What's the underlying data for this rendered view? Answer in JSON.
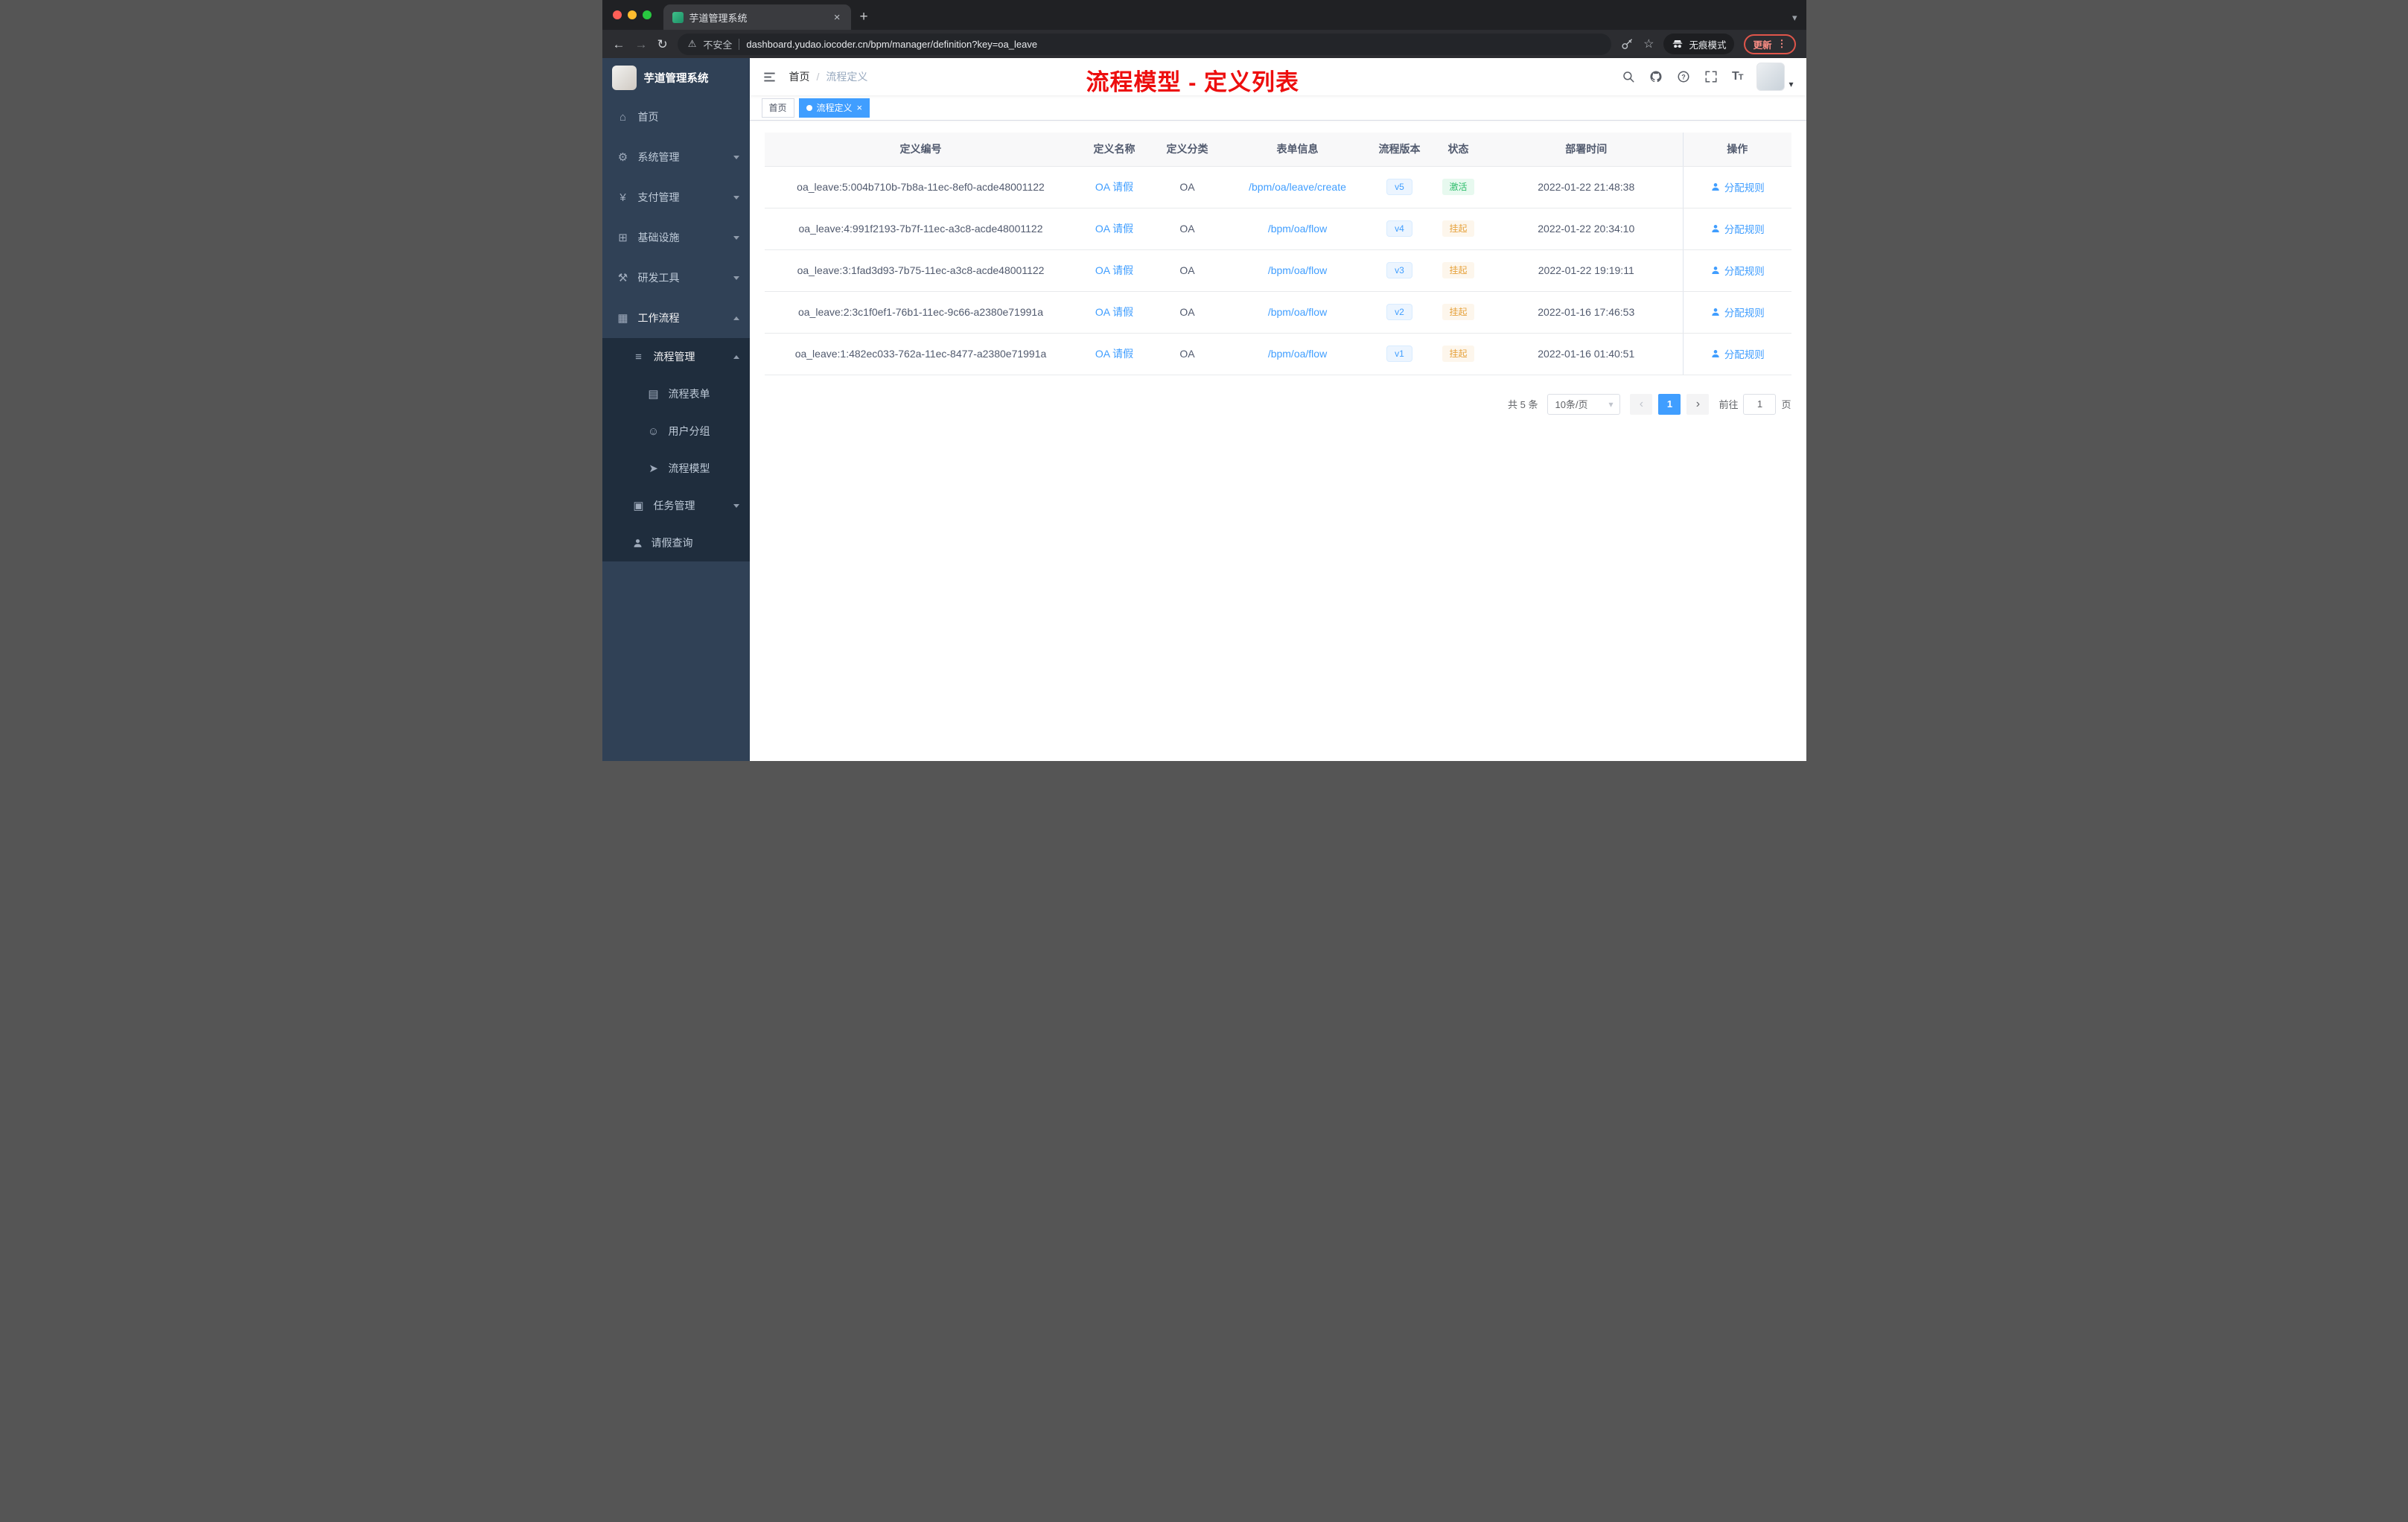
{
  "colors": {
    "accent": "#409eff",
    "sidebar_bg": "#304156",
    "sidebar_sub_bg": "#1f2d3d",
    "success": "#2dbd6b",
    "warning": "#e6a23c",
    "annotation_red": "#ed0e0e"
  },
  "browser": {
    "tab_title": "芋道管理系统",
    "security_label": "不安全",
    "url": "dashboard.yudao.iocoder.cn/bpm/manager/definition?key=oa_leave",
    "incognito_label": "无痕模式",
    "update_label": "更新"
  },
  "sidebar": {
    "title": "芋道管理系统",
    "menu": [
      {
        "label": "首页",
        "icon": "home-icon"
      },
      {
        "label": "系统管理",
        "icon": "gear-icon"
      },
      {
        "label": "支付管理",
        "icon": "yen-icon"
      },
      {
        "label": "基础设施",
        "icon": "infra-icon"
      },
      {
        "label": "研发工具",
        "icon": "tools-icon"
      },
      {
        "label": "工作流程",
        "icon": "workflow-icon"
      },
      {
        "label": "流程管理",
        "icon": "process-icon"
      },
      {
        "label": "流程表单",
        "icon": "form-icon"
      },
      {
        "label": "用户分组",
        "icon": "group-icon"
      },
      {
        "label": "流程模型",
        "icon": "model-icon"
      },
      {
        "label": "任务管理",
        "icon": "task-icon"
      },
      {
        "label": "请假查询",
        "icon": "user-icon"
      }
    ]
  },
  "navbar": {
    "breadcrumb_home": "首页",
    "breadcrumb_sep": "/",
    "breadcrumb_current": "流程定义",
    "annotation": "流程模型 - 定义列表"
  },
  "tags": {
    "home": "首页",
    "active": "流程定义"
  },
  "table": {
    "columns": [
      "定义编号",
      "定义名称",
      "定义分类",
      "表单信息",
      "流程版本",
      "状态",
      "部署时间",
      "操作"
    ],
    "rows": [
      {
        "id": "oa_leave:5:004b710b-7b8a-11ec-8ef0-acde48001122",
        "name": "OA 请假",
        "category": "OA",
        "form": "/bpm/oa/leave/create",
        "version": "v5",
        "status": "激活",
        "time": "2022-01-22 21:48:38",
        "action": "分配规则"
      },
      {
        "id": "oa_leave:4:991f2193-7b7f-11ec-a3c8-acde48001122",
        "name": "OA 请假",
        "category": "OA",
        "form": "/bpm/oa/flow",
        "version": "v4",
        "status": "挂起",
        "time": "2022-01-22 20:34:10",
        "action": "分配规则"
      },
      {
        "id": "oa_leave:3:1fad3d93-7b75-11ec-a3c8-acde48001122",
        "name": "OA 请假",
        "category": "OA",
        "form": "/bpm/oa/flow",
        "version": "v3",
        "status": "挂起",
        "time": "2022-01-22 19:19:11",
        "action": "分配规则"
      },
      {
        "id": "oa_leave:2:3c1f0ef1-76b1-11ec-9c66-a2380e71991a",
        "name": "OA 请假",
        "category": "OA",
        "form": "/bpm/oa/flow",
        "version": "v2",
        "status": "挂起",
        "time": "2022-01-16 17:46:53",
        "action": "分配规则"
      },
      {
        "id": "oa_leave:1:482ec033-762a-11ec-8477-a2380e71991a",
        "name": "OA 请假",
        "category": "OA",
        "form": "/bpm/oa/flow",
        "version": "v1",
        "status": "挂起",
        "time": "2022-01-16 01:40:51",
        "action": "分配规则"
      }
    ]
  },
  "pagination": {
    "total": "共 5 条",
    "page_size": "10条/页",
    "current_page": "1",
    "goto_label": "前往",
    "goto_value": "1",
    "page_label": "页"
  }
}
